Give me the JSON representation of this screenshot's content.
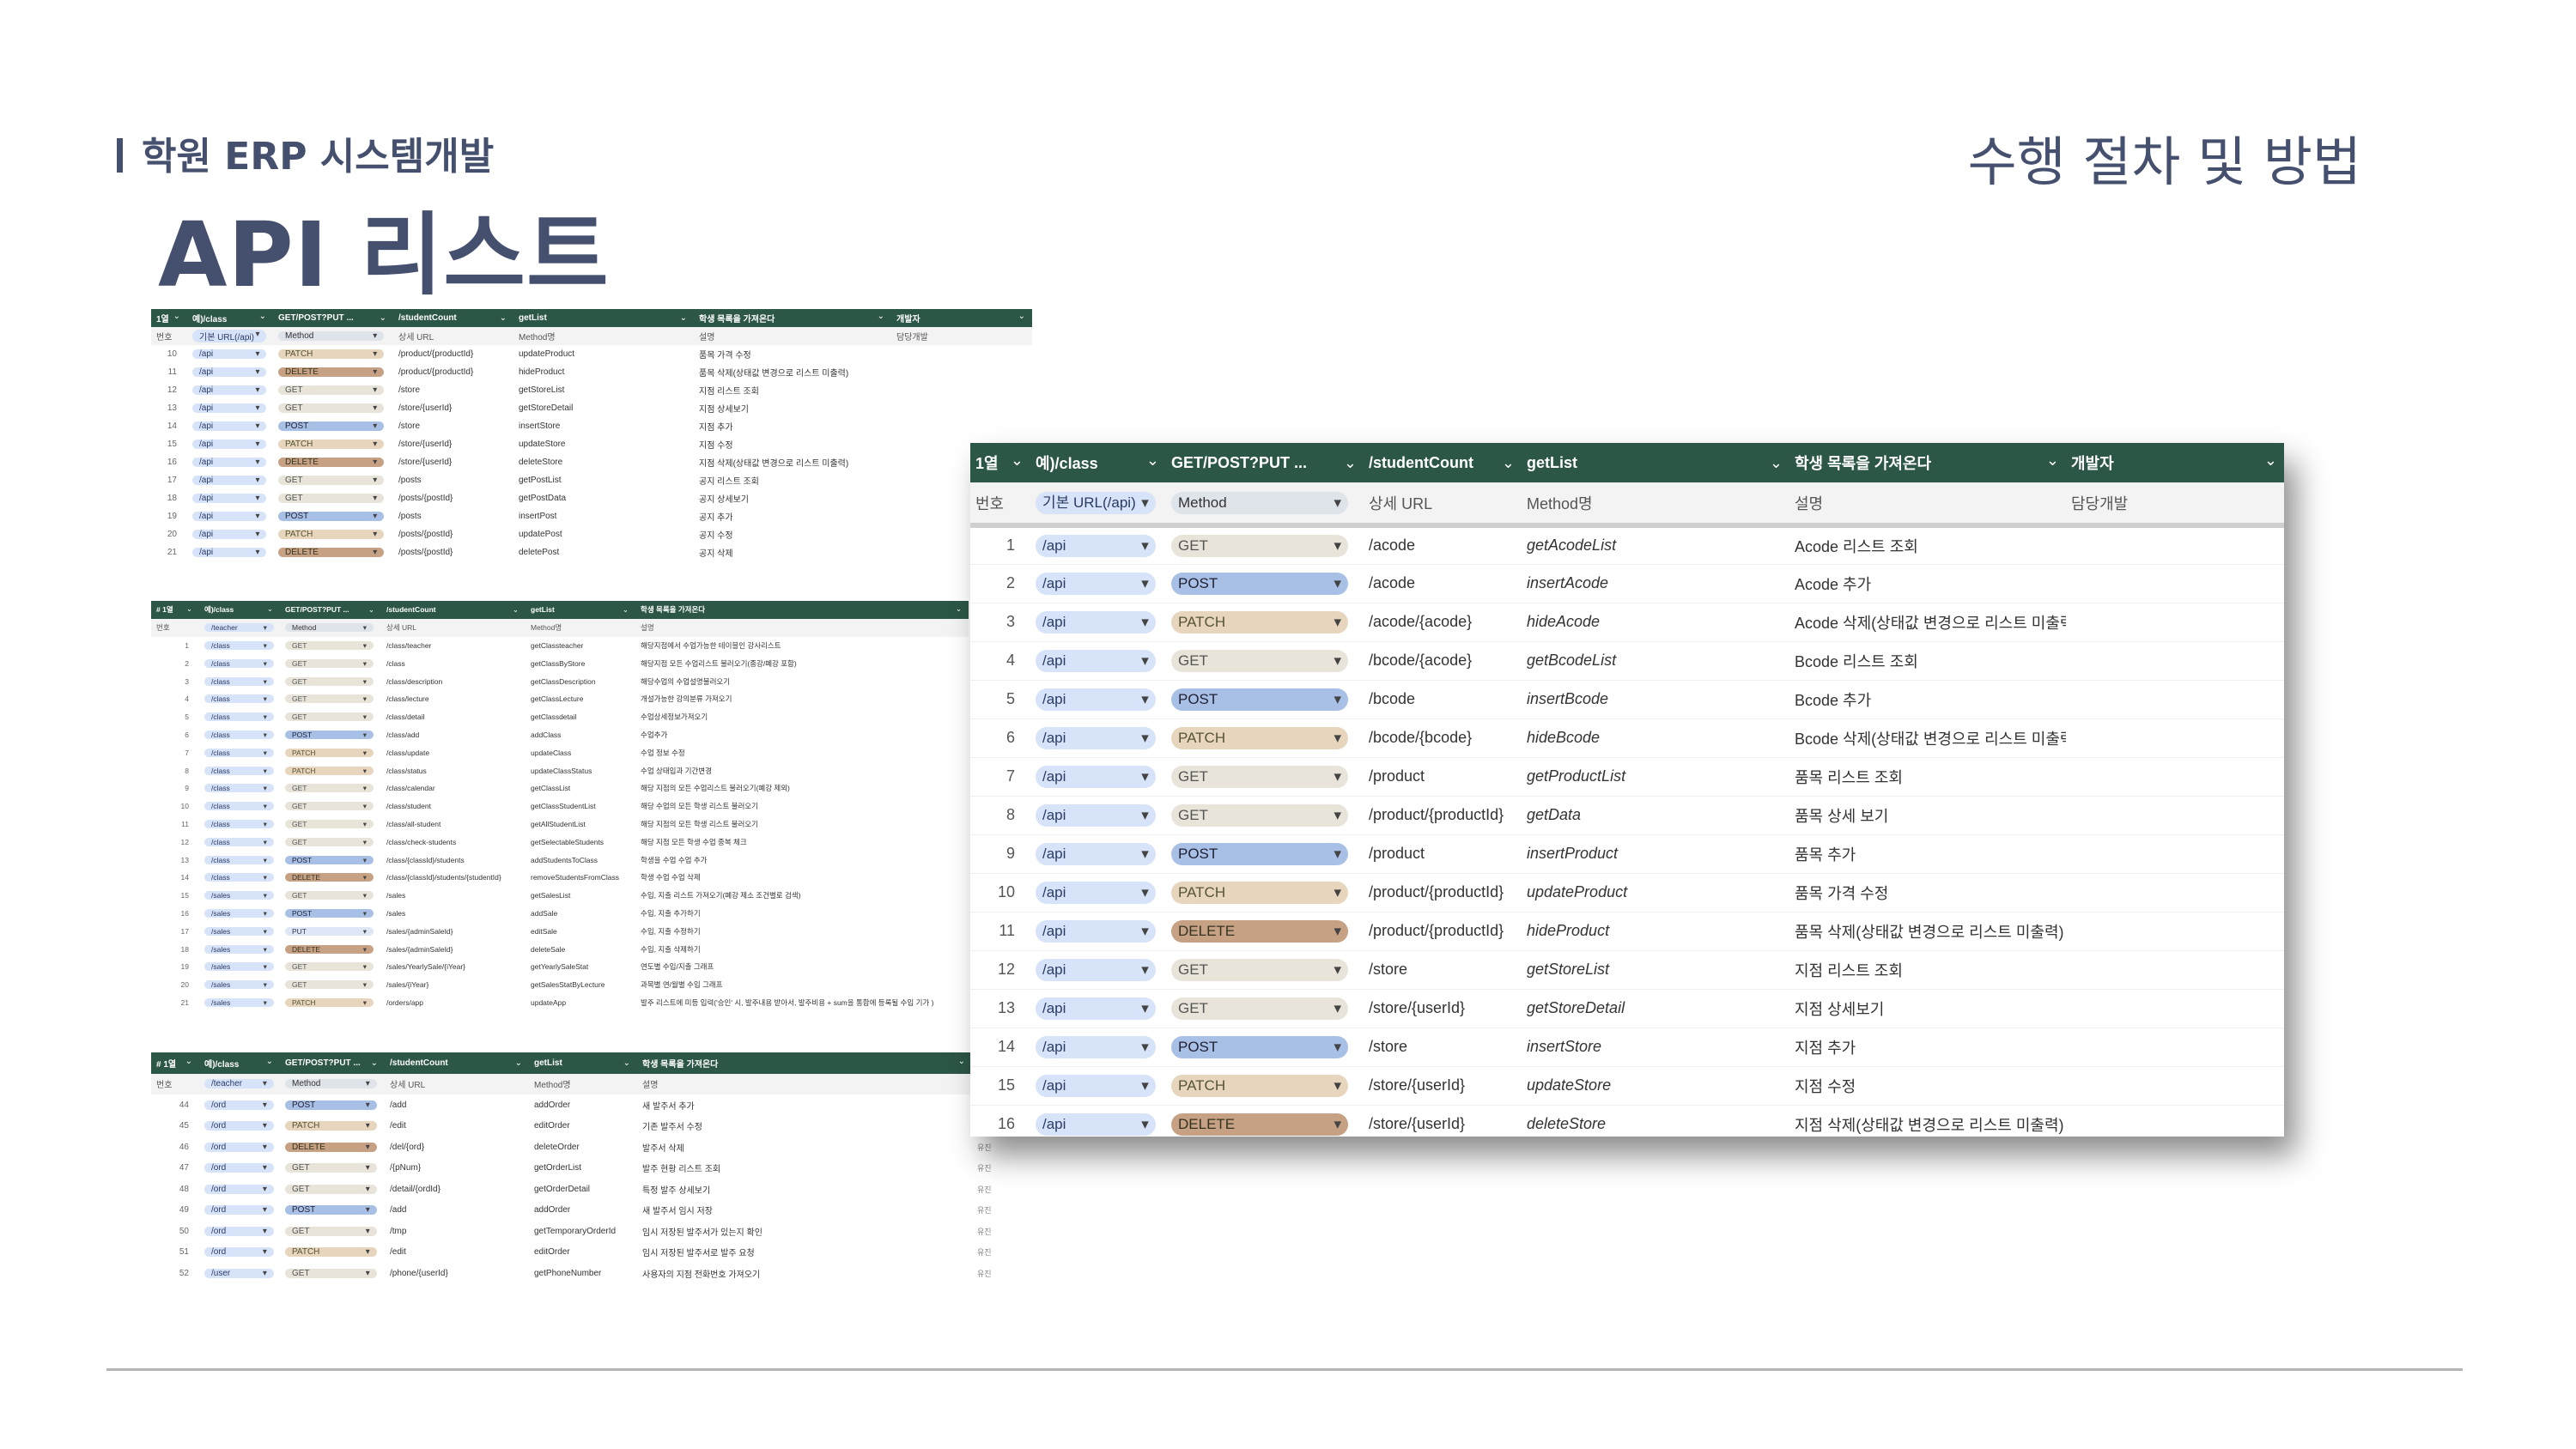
{
  "header": {
    "subtitle": "학원 ERP 시스템개발",
    "title": "API 리스트",
    "section": "수행 절차 및 방법"
  },
  "sheet1": {
    "headers": [
      "1열",
      "예)/class",
      "GET/POST?PUT ...",
      "/studentCount",
      "getList",
      "학생 목록을 가져온다",
      "개발자"
    ],
    "sub": [
      "번호",
      "기본 URL(/api)",
      "Method",
      "상세 URL",
      "Method명",
      "설명",
      "담당개발"
    ],
    "rows": [
      {
        "no": "10",
        "base": "/api",
        "method": "PATCH",
        "url": "/product/{productId}",
        "name": "updateProduct",
        "desc": "품목 가격 수정"
      },
      {
        "no": "11",
        "base": "/api",
        "method": "DELETE",
        "url": "/product/{productId}",
        "name": "hideProduct",
        "desc": "품목 삭제(상태값 변경으로 리스트 미출력)"
      },
      {
        "no": "12",
        "base": "/api",
        "method": "GET",
        "url": "/store",
        "name": "getStoreList",
        "desc": "지점 리스트 조회"
      },
      {
        "no": "13",
        "base": "/api",
        "method": "GET",
        "url": "/store/{userId}",
        "name": "getStoreDetail",
        "desc": "지점 상세보기"
      },
      {
        "no": "14",
        "base": "/api",
        "method": "POST",
        "url": "/store",
        "name": "insertStore",
        "desc": "지점 추가"
      },
      {
        "no": "15",
        "base": "/api",
        "method": "PATCH",
        "url": "/store/{userId}",
        "name": "updateStore",
        "desc": "지점 수정"
      },
      {
        "no": "16",
        "base": "/api",
        "method": "DELETE",
        "url": "/store/{userId}",
        "name": "deleteStore",
        "desc": "지점 삭제(상태값 변경으로 리스트 미출력)"
      },
      {
        "no": "17",
        "base": "/api",
        "method": "GET",
        "url": "/posts",
        "name": "getPostList",
        "desc": "공지 리스트 조회"
      },
      {
        "no": "18",
        "base": "/api",
        "method": "GET",
        "url": "/posts/{postId}",
        "name": "getPostData",
        "desc": "공지 상세보기"
      },
      {
        "no": "19",
        "base": "/api",
        "method": "POST",
        "url": "/posts",
        "name": "insertPost",
        "desc": "공지 추가"
      },
      {
        "no": "20",
        "base": "/api",
        "method": "PATCH",
        "url": "/posts/{postId}",
        "name": "updatePost",
        "desc": "공지 수정"
      },
      {
        "no": "21",
        "base": "/api",
        "method": "DELETE",
        "url": "/posts/{postId}",
        "name": "deletePost",
        "desc": "공지 삭제"
      }
    ]
  },
  "sheet2": {
    "headers": [
      "# 1열",
      "예)/class",
      "GET/POST?PUT ...",
      "/studentCount",
      "getList",
      "학생 목록을 가져온다"
    ],
    "sub": [
      "번호",
      "/teacher",
      "Method",
      "상세 URL",
      "Method명",
      "설명"
    ],
    "rows": [
      {
        "no": "1",
        "base": "/class",
        "method": "GET",
        "url": "/class/teacher",
        "name": "getClassteacher",
        "desc": "해당지점에서 수업가능한 테이블인 강사리스트"
      },
      {
        "no": "2",
        "base": "/class",
        "method": "GET",
        "url": "/class",
        "name": "getClassByStore",
        "desc": "해당지점 모든 수업리스트 불러오기(종강/폐강 포함)"
      },
      {
        "no": "3",
        "base": "/class",
        "method": "GET",
        "url": "/class/description",
        "name": "getClassDescription",
        "desc": "해당수업의 수업설명불러오기"
      },
      {
        "no": "4",
        "base": "/class",
        "method": "GET",
        "url": "/class/lecture",
        "name": "getClassLecture",
        "desc": "개설가능한 강의분류 가져오기"
      },
      {
        "no": "5",
        "base": "/class",
        "method": "GET",
        "url": "/class/detail",
        "name": "getClassdetail",
        "desc": "수업상세정보가져오기"
      },
      {
        "no": "6",
        "base": "/class",
        "method": "POST",
        "url": "/class/add",
        "name": "addClass",
        "desc": "수업추가"
      },
      {
        "no": "7",
        "base": "/class",
        "method": "PATCH",
        "url": "/class/update",
        "name": "updateClass",
        "desc": "수업 정보 수정"
      },
      {
        "no": "8",
        "base": "/class",
        "method": "PATCH",
        "url": "/class/status",
        "name": "updateClassStatus",
        "desc": "수업 상태입과 기간변경"
      },
      {
        "no": "9",
        "base": "/class",
        "method": "GET",
        "url": "/class/calendar",
        "name": "getClassList",
        "desc": "해당 지점의 모든 수업리스트 불러오기(폐강 제외)"
      },
      {
        "no": "10",
        "base": "/class",
        "method": "GET",
        "url": "/class/student",
        "name": "getClassStudentList",
        "desc": "해당 수업의 모든 학생 리스트 불러오기"
      },
      {
        "no": "11",
        "base": "/class",
        "method": "GET",
        "url": "/class/all-student",
        "name": "getAllStudentList",
        "desc": "해당 지점의 모든 학생 리스트 불러오기"
      },
      {
        "no": "12",
        "base": "/class",
        "method": "GET",
        "url": "/class/check-students",
        "name": "getSelectableStudents",
        "desc": "해당 지점 모든 학생 수업 중복 체크"
      },
      {
        "no": "13",
        "base": "/class",
        "method": "POST",
        "url": "/class/{classId}/students",
        "name": "addStudentsToClass",
        "desc": "학생을 수업 수업 추가"
      },
      {
        "no": "14",
        "base": "/class",
        "method": "DELETE",
        "url": "/class/{classId}/students/{studentId}",
        "name": "removeStudentsFromClass",
        "desc": "학생 수업 수업 삭제"
      },
      {
        "no": "15",
        "base": "/sales",
        "method": "GET",
        "url": "/sales",
        "name": "getSalesList",
        "desc": "수입, 지출 리스트 가져오기(폐강 제소 조건별로 검색)"
      },
      {
        "no": "16",
        "base": "/sales",
        "method": "POST",
        "url": "/sales",
        "name": "addSale",
        "desc": "수입, 지출 추가하기"
      },
      {
        "no": "17",
        "base": "/sales",
        "method": "PUT",
        "url": "/sales/{adminSaleId}",
        "name": "editSale",
        "desc": "수입, 지출 수정하기"
      },
      {
        "no": "18",
        "base": "/sales",
        "method": "DELETE",
        "url": "/sales/{adminSaleId}",
        "name": "deleteSale",
        "desc": "수입, 지출 삭제하기"
      },
      {
        "no": "19",
        "base": "/sales",
        "method": "GET",
        "url": "/sales/YearlySale/{iYear}",
        "name": "getYearlySaleStat",
        "desc": "연도별 수입/지출 그래프"
      },
      {
        "no": "20",
        "base": "/sales",
        "method": "GET",
        "url": "/sales/{iYear}",
        "name": "getSalesStatByLecture",
        "desc": "과목별 연/월별 수입 그래프"
      },
      {
        "no": "21",
        "base": "/sales",
        "method": "PATCH",
        "url": "/orders/app",
        "name": "updateApp",
        "desc": "발주 리스트에 미등 입력('승인' 시, 발주내용 받아서, 발주비용 + sum을 통합에 등록될 수입 기가 )"
      }
    ]
  },
  "sheet3": {
    "headers": [
      "# 1열",
      "예)/class",
      "GET/POST?PUT ...",
      "/studentCount",
      "getList",
      "학생 목록을 가져온다"
    ],
    "sub": [
      "번호",
      "/teacher",
      "Method",
      "상세 URL",
      "Method명",
      "설명"
    ],
    "rows": [
      {
        "no": "44",
        "base": "/ord",
        "method": "POST",
        "url": "/add",
        "name": "addOrder",
        "desc": "새 발주서 추가",
        "owner": ""
      },
      {
        "no": "45",
        "base": "/ord",
        "method": "PATCH",
        "url": "/edit",
        "name": "editOrder",
        "desc": "기존 발주서 수정",
        "owner": "유진"
      },
      {
        "no": "46",
        "base": "/ord",
        "method": "DELETE",
        "url": "/del/{ord}",
        "name": "deleteOrder",
        "desc": "발주서 삭제",
        "owner": "유진"
      },
      {
        "no": "47",
        "base": "/ord",
        "method": "GET",
        "url": "/{pNum}",
        "name": "getOrderList",
        "desc": "발주 현황 리스트 조회",
        "owner": "유진"
      },
      {
        "no": "48",
        "base": "/ord",
        "method": "GET",
        "url": "/detail/{ordId}",
        "name": "getOrderDetail",
        "desc": "특정 발주 상세보기",
        "owner": "유진"
      },
      {
        "no": "49",
        "base": "/ord",
        "method": "POST",
        "url": "/add",
        "name": "addOrder",
        "desc": "새 발주서 임시 저장",
        "owner": "유진"
      },
      {
        "no": "50",
        "base": "/ord",
        "method": "GET",
        "url": "/tmp",
        "name": "getTemporaryOrderId",
        "desc": "임시 저장된 발주서가 있는지 확인",
        "owner": "유진"
      },
      {
        "no": "51",
        "base": "/ord",
        "method": "PATCH",
        "url": "/edit",
        "name": "editOrder",
        "desc": "임시 저장된 발주서로 발주 요청",
        "owner": "유진"
      },
      {
        "no": "52",
        "base": "/user",
        "method": "GET",
        "url": "/phone/{userId}",
        "name": "getPhoneNumber",
        "desc": "사용자의 지점 전화번호 가져오기",
        "owner": "유진"
      }
    ]
  },
  "sheet4": {
    "headers": [
      "1열",
      "예)/class",
      "GET/POST?PUT ...",
      "/studentCount",
      "getList",
      "학생 목록을 가져온다",
      "개발자"
    ],
    "sub": [
      "번호",
      "기본 URL(/api)",
      "Method",
      "상세 URL",
      "Method명",
      "설명",
      "담당개발"
    ],
    "rows": [
      {
        "no": "1",
        "base": "/api",
        "method": "GET",
        "url": "/acode",
        "name": "getAcodeList",
        "desc": "Acode 리스트 조회"
      },
      {
        "no": "2",
        "base": "/api",
        "method": "POST",
        "url": "/acode",
        "name": "insertAcode",
        "desc": "Acode 추가"
      },
      {
        "no": "3",
        "base": "/api",
        "method": "PATCH",
        "url": "/acode/{acode}",
        "name": "hideAcode",
        "desc": "Acode 삭제(상태값 변경으로 리스트 미출력)"
      },
      {
        "no": "4",
        "base": "/api",
        "method": "GET",
        "url": "/bcode/{acode}",
        "name": "getBcodeList",
        "desc": "Bcode 리스트 조회"
      },
      {
        "no": "5",
        "base": "/api",
        "method": "POST",
        "url": "/bcode",
        "name": "insertBcode",
        "desc": "Bcode 추가"
      },
      {
        "no": "6",
        "base": "/api",
        "method": "PATCH",
        "url": "/bcode/{bcode}",
        "name": "hideBcode",
        "desc": "Bcode 삭제(상태값 변경으로 리스트 미출력)"
      },
      {
        "no": "7",
        "base": "/api",
        "method": "GET",
        "url": "/product",
        "name": "getProductList",
        "desc": "품목 리스트 조회"
      },
      {
        "no": "8",
        "base": "/api",
        "method": "GET",
        "url": "/product/{productId}",
        "name": "getData",
        "desc": "품목 상세 보기"
      },
      {
        "no": "9",
        "base": "/api",
        "method": "POST",
        "url": "/product",
        "name": "insertProduct",
        "desc": "품목 추가"
      },
      {
        "no": "10",
        "base": "/api",
        "method": "PATCH",
        "url": "/product/{productId}",
        "name": "updateProduct",
        "desc": "품목 가격 수정"
      },
      {
        "no": "11",
        "base": "/api",
        "method": "DELETE",
        "url": "/product/{productId}",
        "name": "hideProduct",
        "desc": "품목 삭제(상태값 변경으로 리스트 미출력)"
      },
      {
        "no": "12",
        "base": "/api",
        "method": "GET",
        "url": "/store",
        "name": "getStoreList",
        "desc": "지점 리스트 조회"
      },
      {
        "no": "13",
        "base": "/api",
        "method": "GET",
        "url": "/store/{userId}",
        "name": "getStoreDetail",
        "desc": "지점 상세보기"
      },
      {
        "no": "14",
        "base": "/api",
        "method": "POST",
        "url": "/store",
        "name": "insertStore",
        "desc": "지점 추가"
      },
      {
        "no": "15",
        "base": "/api",
        "method": "PATCH",
        "url": "/store/{userId}",
        "name": "updateStore",
        "desc": "지점 수정"
      },
      {
        "no": "16",
        "base": "/api",
        "method": "DELETE",
        "url": "/store/{userId}",
        "name": "deleteStore",
        "desc": "지점 삭제(상태값 변경으로 리스트 미출력)"
      }
    ]
  }
}
